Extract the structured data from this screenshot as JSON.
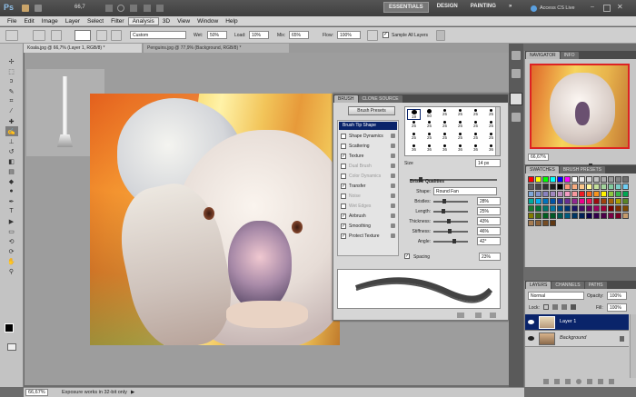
{
  "app": {
    "logo": "Ps",
    "zoom_readout": "66,7",
    "workspace_buttons": [
      "ESSENTIALS",
      "DESIGN",
      "PAINTING",
      "»"
    ],
    "cs_live": "Access CS Live"
  },
  "menu": [
    "File",
    "Edit",
    "Image",
    "Layer",
    "Select",
    "Filter",
    "Analysis",
    "3D",
    "View",
    "Window",
    "Help"
  ],
  "options": {
    "preset": "Custom",
    "wet_label": "Wet:",
    "wet_value": "50%",
    "load_label": "Load:",
    "load_value": "10%",
    "mix_label": "Mix:",
    "mix_value": "65%",
    "flow_label": "Flow:",
    "flow_value": "100%",
    "sample_all_layers": "Sample All Layers"
  },
  "doc_tabs": [
    {
      "label": "Koala.jpg @ 66,7% (Layer 1, RGB/8) *",
      "active": true
    },
    {
      "label": "Penguins.jpg @ 77,9% (Background, RGB/8) *",
      "active": false
    }
  ],
  "brush_panel": {
    "tabs": [
      "BRUSH",
      "CLONE SOURCE"
    ],
    "presets_button": "Brush Presets",
    "tip_shape": "Brush Tip Shape",
    "options": [
      {
        "label": "Shape Dynamics",
        "checked": false,
        "enabled": true
      },
      {
        "label": "Scattering",
        "checked": false,
        "enabled": true
      },
      {
        "label": "Texture",
        "checked": true,
        "enabled": true
      },
      {
        "label": "Dual Brush",
        "checked": false,
        "enabled": false
      },
      {
        "label": "Color Dynamics",
        "checked": false,
        "enabled": false
      },
      {
        "label": "Transfer",
        "checked": true,
        "enabled": true
      },
      {
        "label": "Noise",
        "checked": false,
        "enabled": false
      },
      {
        "label": "Wet Edges",
        "checked": false,
        "enabled": false
      },
      {
        "label": "Airbrush",
        "checked": true,
        "enabled": true
      },
      {
        "label": "Smoothing",
        "checked": true,
        "enabled": true
      },
      {
        "label": "Protect Texture",
        "checked": true,
        "enabled": true
      }
    ],
    "tip_sizes": [
      "19",
      "60",
      "25",
      "25",
      "25",
      "25",
      "25",
      "25",
      "25",
      "25",
      "25",
      "25",
      "25",
      "25",
      "25",
      "25",
      "25",
      "25",
      "36",
      "36",
      "36",
      "36",
      "36",
      "36"
    ],
    "size_label": "Size",
    "size_value": "14 px",
    "bristle_title": "Bristle Qualities",
    "bristle_rows": [
      {
        "label": "Shape:",
        "value": "Round Fan",
        "fraction": null
      },
      {
        "label": "Bristles:",
        "value": "28%",
        "fraction": 0.28
      },
      {
        "label": "Length:",
        "value": "25%",
        "fraction": 0.25
      },
      {
        "label": "Thickness:",
        "value": "43%",
        "fraction": 0.43
      },
      {
        "label": "Stiffness:",
        "value": "46%",
        "fraction": 0.46
      },
      {
        "label": "Angle:",
        "value": "42°",
        "fraction": 0.62
      }
    ],
    "spacing_label": "Spacing",
    "spacing_value": "23%"
  },
  "navigator": {
    "tabs": [
      "NAVIGATOR",
      "INFO"
    ],
    "zoom": "66,67%"
  },
  "swatches": {
    "tabs": [
      "SWATCHES",
      "BRUSH PRESETS"
    ],
    "colors": [
      "#ff0000",
      "#ffff00",
      "#00ff00",
      "#00ffff",
      "#0000ff",
      "#ff00ff",
      "#ffffff",
      "#ebebeb",
      "#d6d6d6",
      "#c2c2c2",
      "#adadad",
      "#999999",
      "#858585",
      "#707070",
      "#5c5c5c",
      "#474747",
      "#333333",
      "#1f1f1f",
      "#000000",
      "#f7977a",
      "#f9ad81",
      "#fdc68a",
      "#fff79a",
      "#c4df9b",
      "#a3d39c",
      "#82ca9d",
      "#7bcdc8",
      "#6ecff6",
      "#7ea7d8",
      "#8493ca",
      "#8882be",
      "#a187be",
      "#bc8dbf",
      "#f49ac2",
      "#f6989d",
      "#ed1c24",
      "#f26522",
      "#f7941d",
      "#fff200",
      "#8dc63f",
      "#39b54a",
      "#00a651",
      "#00a99d",
      "#00aeef",
      "#0072bc",
      "#0054a6",
      "#2e3192",
      "#662d91",
      "#92278f",
      "#ec008c",
      "#ed145b",
      "#9e0b0f",
      "#a0410d",
      "#a36209",
      "#aba000",
      "#598527",
      "#197b30",
      "#007236",
      "#00746b",
      "#0076a3",
      "#004b80",
      "#003471",
      "#1b1464",
      "#440e62",
      "#630460",
      "#9e005d",
      "#9e0039",
      "#790000",
      "#7b2e00",
      "#7d4900",
      "#827b00",
      "#406618",
      "#005e20",
      "#005826",
      "#005952",
      "#005b7f",
      "#003663",
      "#002157",
      "#0d004c",
      "#32004b",
      "#4b0049",
      "#7b0046",
      "#7a0026",
      "#c69c6d",
      "#a67c52",
      "#8c6239",
      "#754c24",
      "#603813"
    ]
  },
  "layers": {
    "tabs": [
      "LAYERS",
      "CHANNELS",
      "PATHS"
    ],
    "blend_mode": "Normal",
    "opacity_label": "Opacity:",
    "opacity_value": "100%",
    "lock_label": "Lock:",
    "fill_label": "Fill:",
    "fill_value": "100%",
    "items": [
      {
        "name": "Layer 1",
        "selected": true
      },
      {
        "name": "Background",
        "selected": false
      }
    ]
  },
  "status": {
    "zoom": "66,67%",
    "message": "Exposure works in 32-bit only"
  },
  "colors": {
    "accent": "#0a246a",
    "selection": "#1d3f8a"
  }
}
